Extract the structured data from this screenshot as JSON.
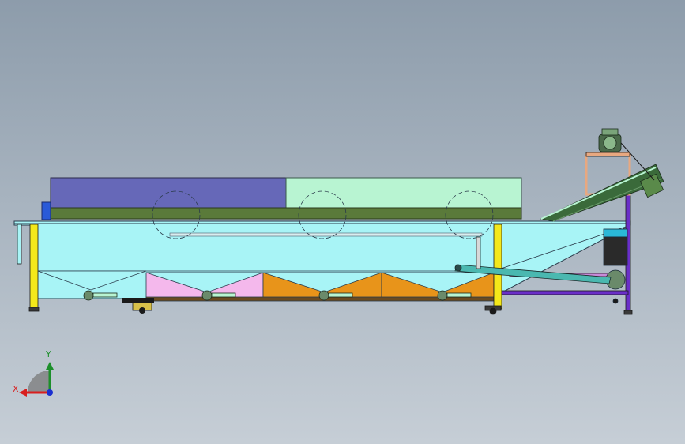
{
  "viewport": {
    "background_top": "#8d9cab",
    "background_bottom": "#c6ced6"
  },
  "axis_triad": {
    "x_label": "X",
    "y_label": "Y",
    "x_color": "#d81e1e",
    "y_color": "#1c8f2a",
    "z_color": "#1a2fd0"
  },
  "model_colors": {
    "tank": "#a8f4f6",
    "cover_left": "#6668b8",
    "cover_right": "#b8f4d2",
    "cover_strip": "#5a7a3a",
    "hopper_pink": "#f4b8ec",
    "hopper_orange": "#e8941a",
    "legs": "#f4e81a",
    "frame_purple": "#6a2fc8",
    "conveyor": "#3a6a3a",
    "pump": "#2ab8d8",
    "pipe": "#4ab8b0"
  }
}
